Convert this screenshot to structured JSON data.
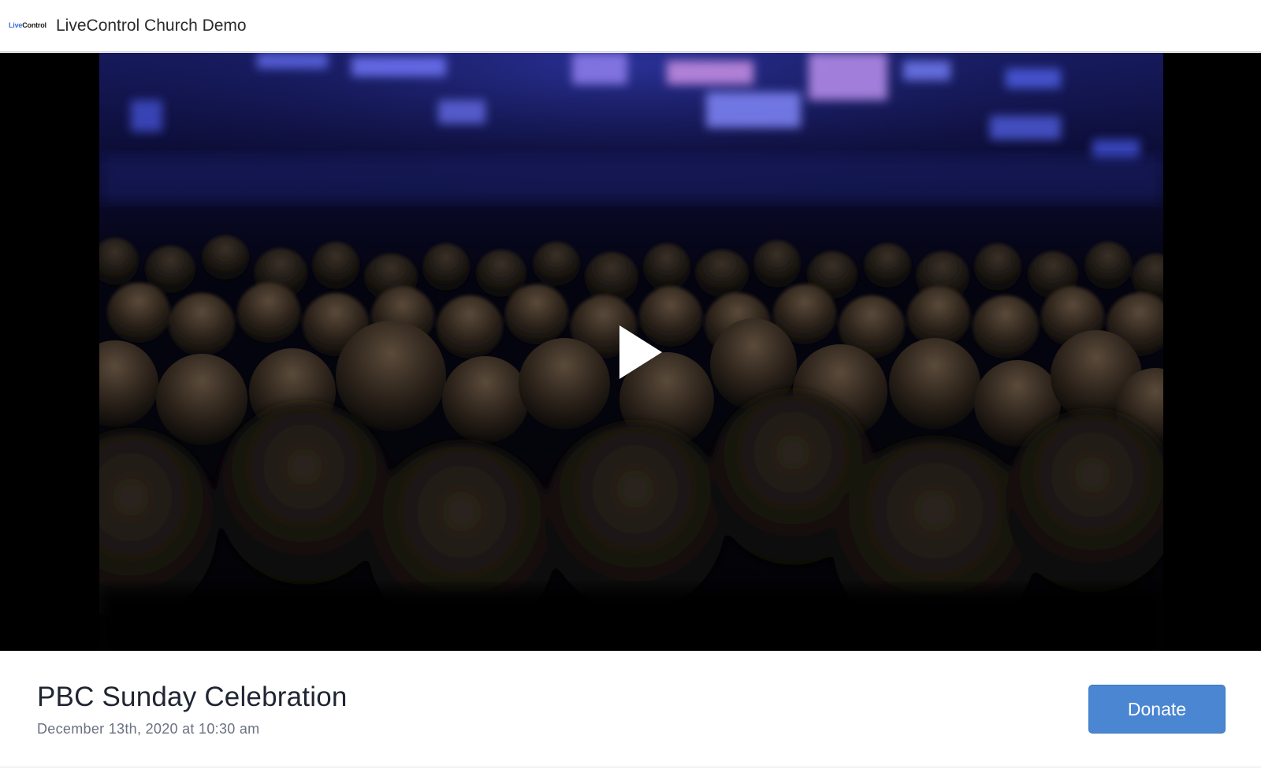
{
  "header": {
    "logo_text_live": "Live",
    "logo_text_control": "Control",
    "site_title": "LiveControl Church Demo"
  },
  "player": {
    "play_icon": "play-icon",
    "state": "paused"
  },
  "event": {
    "title": "PBC Sunday Celebration",
    "date": "December 13th, 2020 at 10:30 am"
  },
  "actions": {
    "donate_label": "Donate"
  },
  "colors": {
    "accent": "#4a86d1",
    "logo_blue": "#3c6fd6",
    "title_text": "#1f2533",
    "muted_text": "#6a7180",
    "player_bg": "#000000"
  }
}
